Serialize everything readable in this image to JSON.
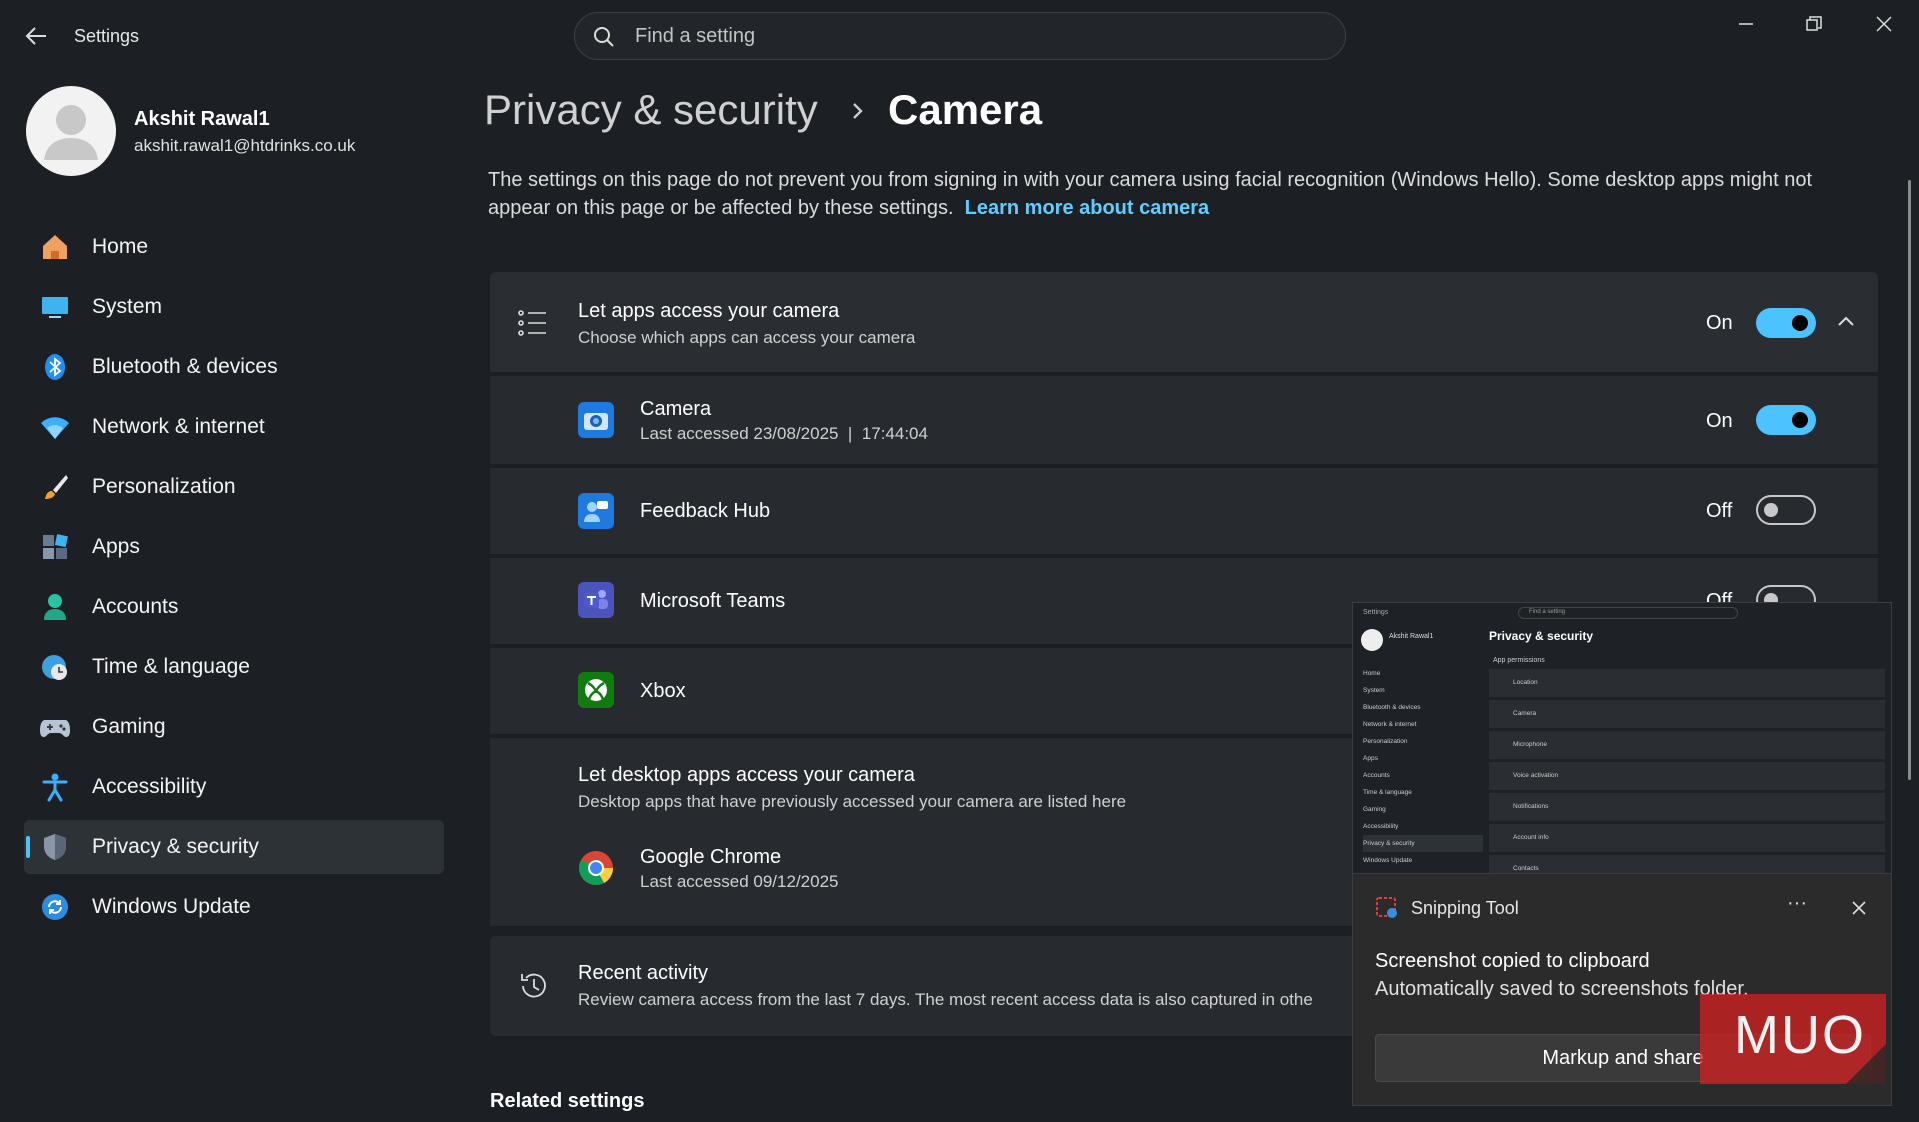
{
  "window": {
    "title": "Settings"
  },
  "search": {
    "placeholder": "Find a setting"
  },
  "profile": {
    "name": "Akshit Rawal1",
    "email": "akshit.rawal1@htdrinks.co.uk"
  },
  "sidebar": {
    "items": [
      {
        "label": "Home",
        "icon": "home-icon"
      },
      {
        "label": "System",
        "icon": "monitor-icon"
      },
      {
        "label": "Bluetooth & devices",
        "icon": "bluetooth-icon"
      },
      {
        "label": "Network & internet",
        "icon": "wifi-icon"
      },
      {
        "label": "Personalization",
        "icon": "paintbrush-icon"
      },
      {
        "label": "Apps",
        "icon": "apps-icon"
      },
      {
        "label": "Accounts",
        "icon": "person-icon"
      },
      {
        "label": "Time & language",
        "icon": "globe-clock-icon"
      },
      {
        "label": "Gaming",
        "icon": "gamepad-icon"
      },
      {
        "label": "Accessibility",
        "icon": "accessibility-icon"
      },
      {
        "label": "Privacy & security",
        "icon": "shield-icon",
        "active": true
      },
      {
        "label": "Windows Update",
        "icon": "refresh-icon"
      }
    ]
  },
  "breadcrumb": {
    "parent": "Privacy & security",
    "current": "Camera"
  },
  "description": {
    "text": "The settings on this page do not prevent you from signing in with your camera using facial recognition (Windows Hello). Some desktop apps might not appear on this page or be affected by these settings.",
    "link": "Learn more about camera"
  },
  "main": {
    "let_apps": {
      "title": "Let apps access your camera",
      "subtitle": "Choose which apps can access your camera",
      "state": "On"
    },
    "apps": [
      {
        "name": "Camera",
        "last_accessed": "Last accessed 23/08/2025  |  17:44:04",
        "state": "On"
      },
      {
        "name": "Feedback Hub",
        "state": "Off"
      },
      {
        "name": "Microsoft Teams",
        "state": "Off"
      },
      {
        "name": "Xbox"
      }
    ],
    "desktop": {
      "title": "Let desktop apps access your camera",
      "subtitle": "Desktop apps that have previously accessed your camera are listed here"
    },
    "desktop_apps": [
      {
        "name": "Google Chrome",
        "last_accessed": "Last accessed 09/12/2025"
      }
    ],
    "recent": {
      "title": "Recent activity",
      "subtitle": "Review camera access from the last 7 days. The most recent access data is also captured in othe"
    },
    "related": "Related settings"
  },
  "snip_preview": {
    "title": "Settings",
    "search": "Find a setting",
    "heading": "Privacy & security",
    "section": "App permissions",
    "name": "Akshit Rawal1",
    "nav": [
      "Home",
      "System",
      "Bluetooth & devices",
      "Network & internet",
      "Personalization",
      "Apps",
      "Accounts",
      "Time & language",
      "Gaming",
      "Accessibility",
      "Privacy & security",
      "Windows Update"
    ],
    "rows": [
      "Location",
      "Camera",
      "Microphone",
      "Voice activation",
      "Notifications",
      "Account info",
      "Contacts"
    ]
  },
  "toast": {
    "app": "Snipping Tool",
    "title": "Screenshot copied to clipboard",
    "body": "Automatically saved to screenshots folder.",
    "button": "Markup and share",
    "more": "···"
  },
  "watermark": "MUO",
  "colors": {
    "accent": "#4cc2ff",
    "link": "#60cdff",
    "background": "#1c2024",
    "card": "#2a2e32"
  }
}
